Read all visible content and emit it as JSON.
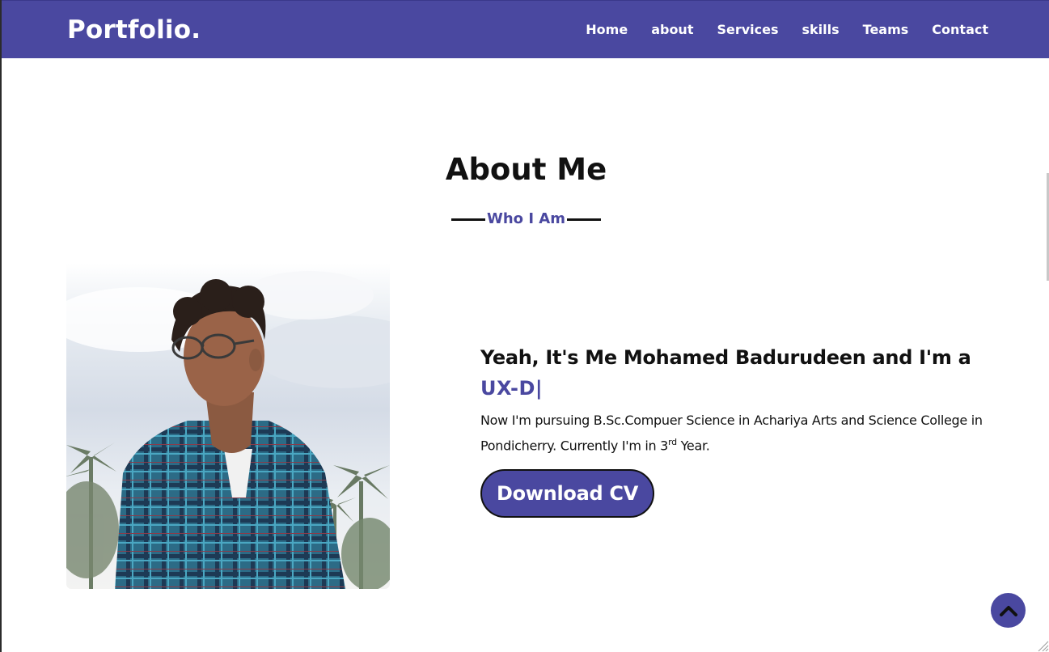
{
  "nav": {
    "brand": "Portfolio.",
    "links": [
      {
        "label": "Home"
      },
      {
        "label": "about"
      },
      {
        "label": "Services"
      },
      {
        "label": "skills"
      },
      {
        "label": "Teams"
      },
      {
        "label": "Contact"
      }
    ]
  },
  "about": {
    "title": "About Me",
    "subtitle": "Who I Am",
    "heading": "Yeah, It's Me Mohamed Badurudeen and I'm a",
    "typed_text": "UX-D|",
    "description_main": "Now I'm pursuing B.Sc.Compuer Science in Achariya Arts and Science College in Pondicherry. Currently I'm in 3",
    "description_sup": "rd",
    "description_end": " Year.",
    "cv_button_label": "Download CV"
  },
  "icons": {
    "scroll_top": "chevron-up-icon"
  },
  "colors": {
    "accent": "#4a48a0",
    "text": "#111111",
    "background": "#ffffff"
  }
}
